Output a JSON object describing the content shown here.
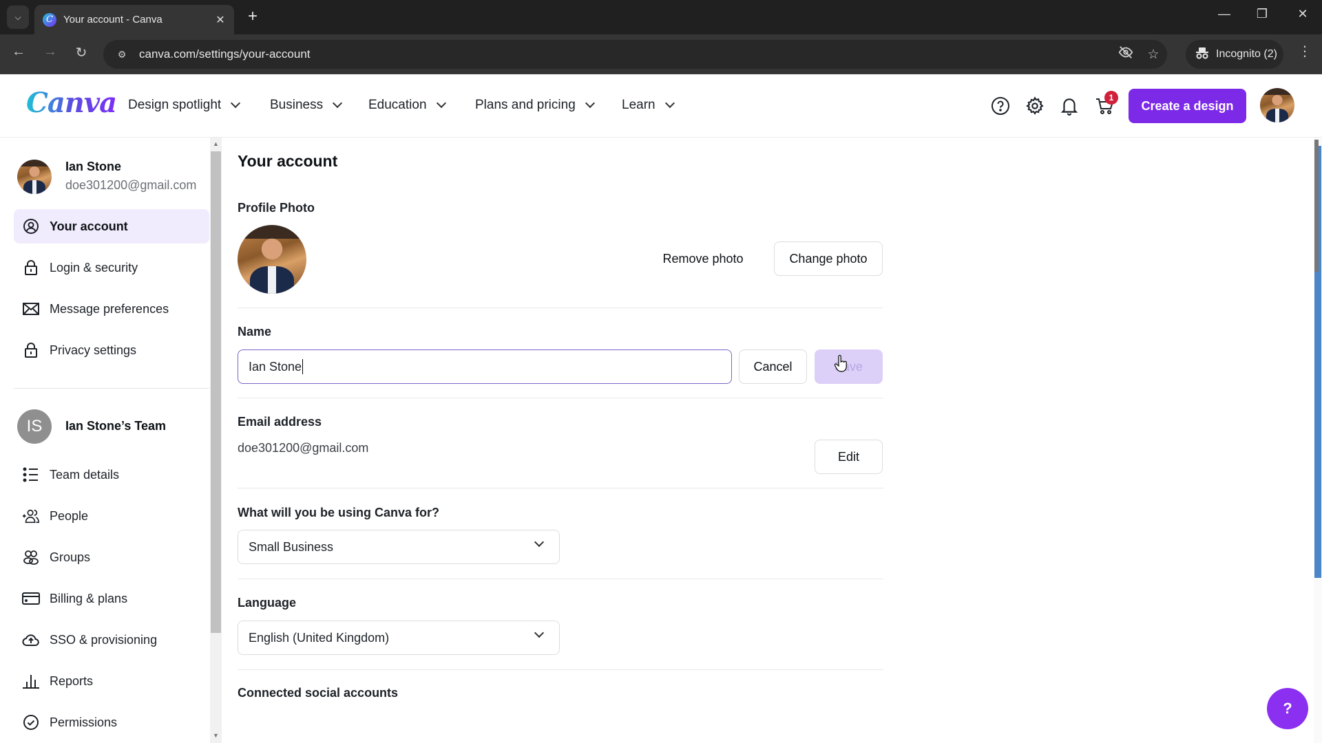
{
  "browser": {
    "tab_title": "Your account - Canva",
    "url": "canva.com/settings/your-account",
    "incognito_label": "Incognito (2)"
  },
  "header": {
    "logo": "Canva",
    "nav": [
      {
        "label": "Design spotlight"
      },
      {
        "label": "Business"
      },
      {
        "label": "Education"
      },
      {
        "label": "Plans and pricing"
      },
      {
        "label": "Learn"
      }
    ],
    "cart_count": "1",
    "create_button": "Create a design",
    "brand_color": "#7d2ae8"
  },
  "sidebar": {
    "user_name": "Ian Stone",
    "user_email": "doe301200@gmail.com",
    "account_items": [
      {
        "label": "Your account",
        "icon": "user-circle-icon",
        "active": true
      },
      {
        "label": "Login & security",
        "icon": "lock-icon"
      },
      {
        "label": "Message preferences",
        "icon": "envelope-icon"
      },
      {
        "label": "Privacy settings",
        "icon": "lock-icon"
      }
    ],
    "team_initials": "IS",
    "team_name": "Ian Stone’s Team",
    "team_items": [
      {
        "label": "Team details",
        "icon": "list-icon"
      },
      {
        "label": "People",
        "icon": "add-people-icon"
      },
      {
        "label": "Groups",
        "icon": "groups-icon"
      },
      {
        "label": "Billing & plans",
        "icon": "credit-card-icon"
      },
      {
        "label": "SSO & provisioning",
        "icon": "cloud-upload-icon"
      },
      {
        "label": "Reports",
        "icon": "bar-chart-icon"
      },
      {
        "label": "Permissions",
        "icon": "check-circle-icon"
      }
    ]
  },
  "main": {
    "title": "Your account",
    "profile_photo_label": "Profile Photo",
    "remove_photo": "Remove photo",
    "change_photo": "Change photo",
    "name_label": "Name",
    "name_value": "Ian Stone",
    "cancel": "Cancel",
    "save": "Save",
    "email_label": "Email address",
    "email_value": "doe301200@gmail.com",
    "edit": "Edit",
    "usage_label": "What will you be using Canva for?",
    "usage_value": "Small Business",
    "language_label": "Language",
    "language_value": "English (United Kingdom)",
    "social_label": "Connected social accounts"
  },
  "help_button": "?"
}
